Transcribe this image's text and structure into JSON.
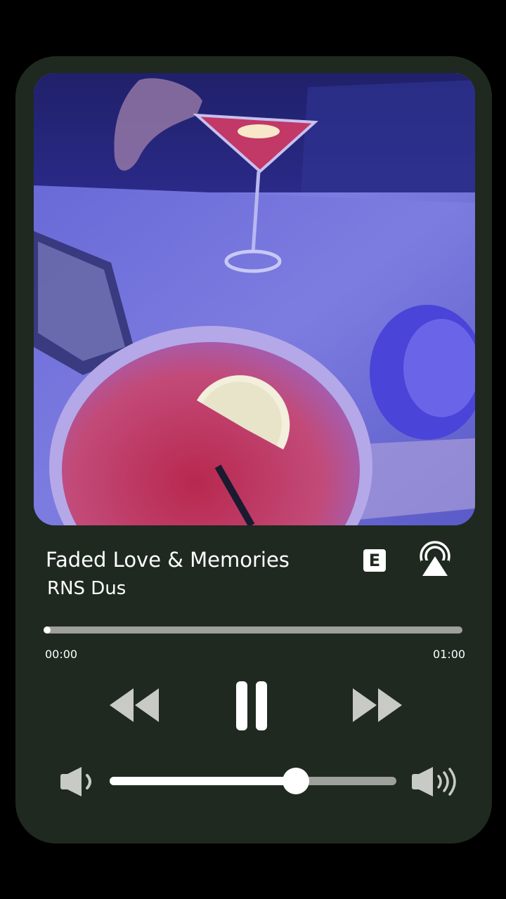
{
  "track": {
    "title": "Faded Love & Memories",
    "artist": "RNS Dus",
    "explicit_badge": "E",
    "artwork": "cocktail-photo"
  },
  "playback": {
    "elapsed": "00:00",
    "total": "01:00",
    "progress_fraction": 0.0,
    "state": "playing"
  },
  "volume": {
    "level_fraction": 0.65
  },
  "icons": {
    "rewind": "rewind-icon",
    "pause": "pause-icon",
    "forward": "fast-forward-icon",
    "volume_low": "volume-low-icon",
    "volume_high": "volume-high-icon",
    "airplay": "airplay-icon"
  },
  "colors": {
    "background": "#000000",
    "card": "#1f2920",
    "primary": "#ffffff",
    "track_inactive": "#9ea09b",
    "control_icon": "#c8cac6"
  }
}
